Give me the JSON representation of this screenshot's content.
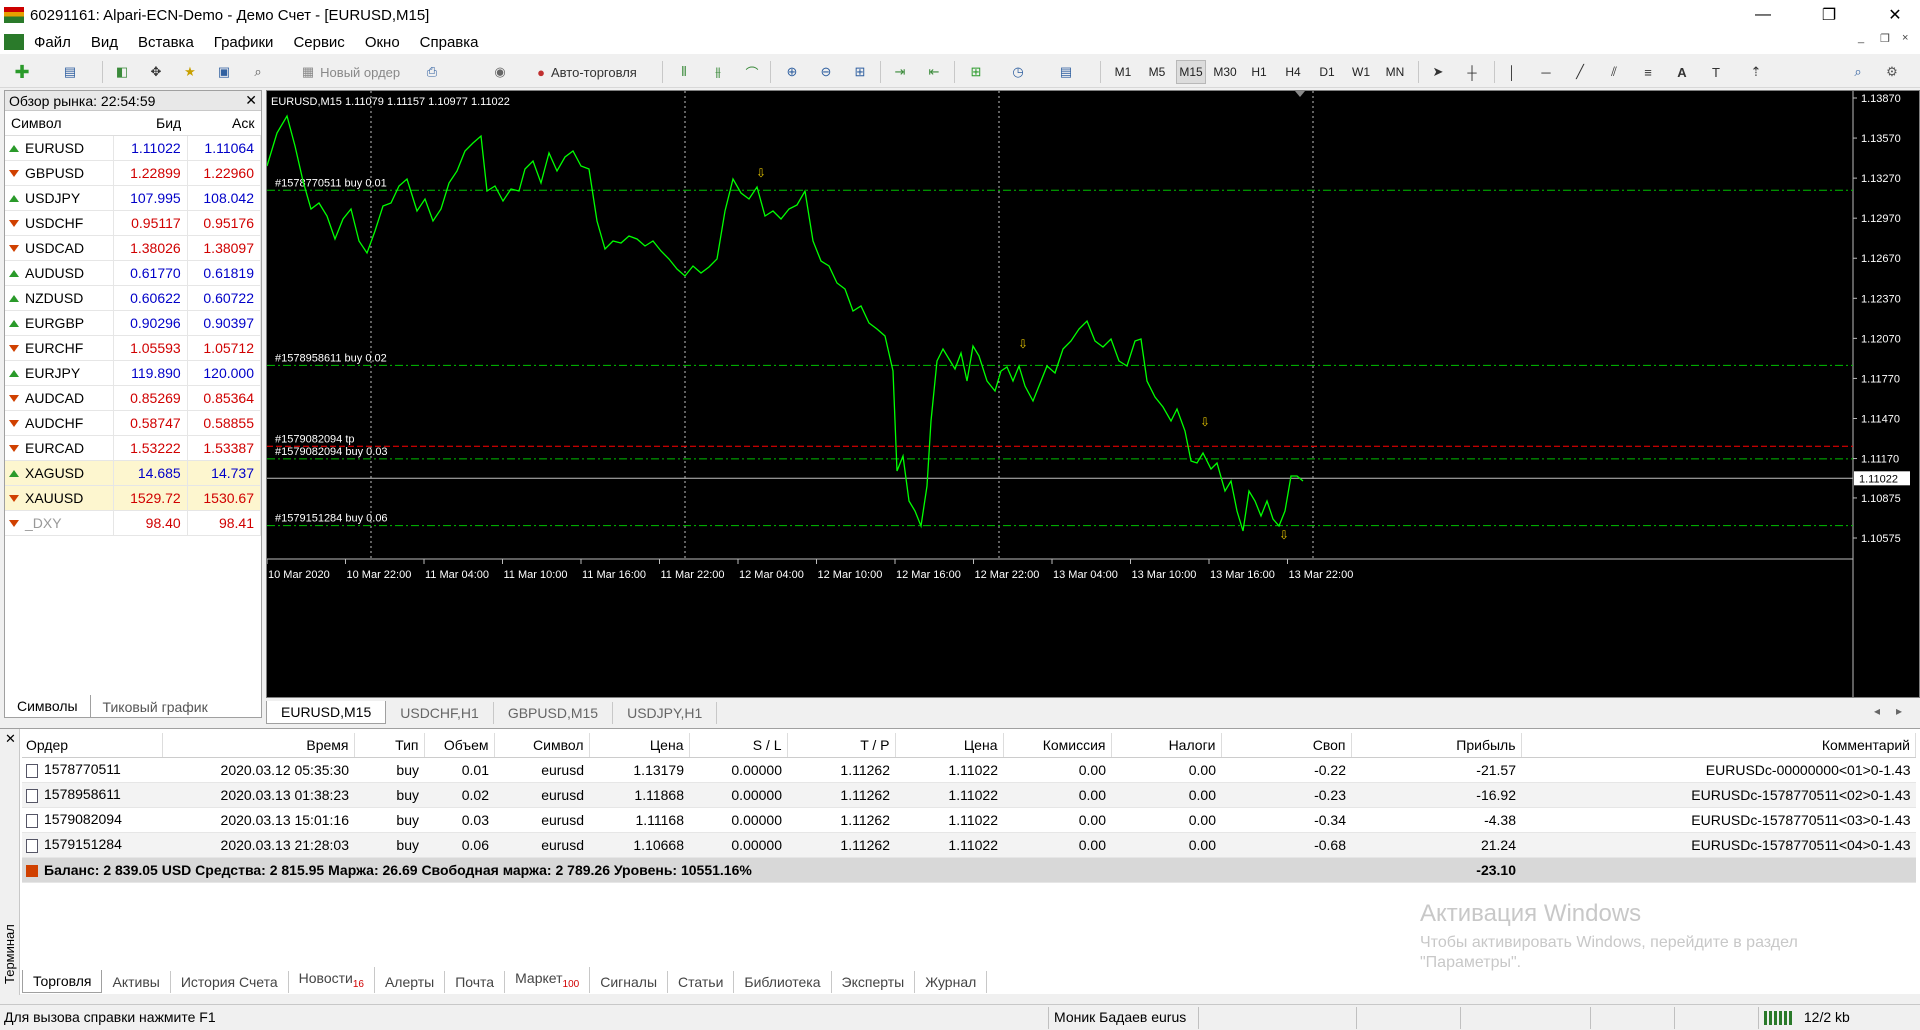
{
  "window": {
    "title": "60291161: Alpari-ECN-Demo - Демо Счет - [EURUSD,M15]",
    "minimize": "—",
    "maximize": "❐",
    "close": "✕"
  },
  "menu": {
    "items": [
      "Файл",
      "Вид",
      "Вставка",
      "Графики",
      "Сервис",
      "Окно",
      "Справка"
    ],
    "mdi_controls": [
      "_",
      "❐",
      "×"
    ]
  },
  "toolbar": {
    "new_order": "Новый ордер",
    "auto_trading": "Авто-торговля",
    "timeframes": [
      "M1",
      "M5",
      "M15",
      "M30",
      "H1",
      "H4",
      "D1",
      "W1",
      "MN"
    ],
    "active_timeframe": "M15"
  },
  "market_watch": {
    "header": "Обзор рынка: 22:54:59",
    "columns": [
      "Символ",
      "Бид",
      "Аск"
    ],
    "rows": [
      {
        "symbol": "EURUSD",
        "dir": "up",
        "bid": "1.11022",
        "ask": "1.11064",
        "color": "blue"
      },
      {
        "symbol": "GBPUSD",
        "dir": "down",
        "bid": "1.22899",
        "ask": "1.22960",
        "color": "red"
      },
      {
        "symbol": "USDJPY",
        "dir": "up",
        "bid": "107.995",
        "ask": "108.042",
        "color": "blue"
      },
      {
        "symbol": "USDCHF",
        "dir": "down",
        "bid": "0.95117",
        "ask": "0.95176",
        "color": "red"
      },
      {
        "symbol": "USDCAD",
        "dir": "down",
        "bid": "1.38026",
        "ask": "1.38097",
        "color": "red"
      },
      {
        "symbol": "AUDUSD",
        "dir": "up",
        "bid": "0.61770",
        "ask": "0.61819",
        "color": "blue"
      },
      {
        "symbol": "NZDUSD",
        "dir": "up",
        "bid": "0.60622",
        "ask": "0.60722",
        "color": "blue"
      },
      {
        "symbol": "EURGBP",
        "dir": "up",
        "bid": "0.90296",
        "ask": "0.90397",
        "color": "blue"
      },
      {
        "symbol": "EURCHF",
        "dir": "down",
        "bid": "1.05593",
        "ask": "1.05712",
        "color": "red"
      },
      {
        "symbol": "EURJPY",
        "dir": "up",
        "bid": "119.890",
        "ask": "120.000",
        "color": "blue"
      },
      {
        "symbol": "AUDCAD",
        "dir": "down",
        "bid": "0.85269",
        "ask": "0.85364",
        "color": "red"
      },
      {
        "symbol": "AUDCHF",
        "dir": "down",
        "bid": "0.58747",
        "ask": "0.58855",
        "color": "red"
      },
      {
        "symbol": "EURCAD",
        "dir": "down",
        "bid": "1.53222",
        "ask": "1.53387",
        "color": "red"
      },
      {
        "symbol": "XAGUSD",
        "dir": "up",
        "bid": "14.685",
        "ask": "14.737",
        "color": "blue",
        "highlight": true
      },
      {
        "symbol": "XAUUSD",
        "dir": "down",
        "bid": "1529.72",
        "ask": "1530.67",
        "color": "red",
        "highlight": true
      },
      {
        "symbol": "_DXY",
        "dir": "down",
        "bid": "98.40",
        "ask": "98.41",
        "color": "red",
        "muted": true
      }
    ],
    "tabs": [
      "Символы",
      "Тиковый график"
    ]
  },
  "chart": {
    "header": "EURUSD,M15  1.11079 1.11157 1.10977 1.11022",
    "price_ticks": [
      "1.13870",
      "1.13570",
      "1.13270",
      "1.12970",
      "1.12670",
      "1.12370",
      "1.12070",
      "1.11770",
      "1.11470",
      "1.11170",
      "1.10875",
      "1.10575"
    ],
    "current_price": "1.11022",
    "time_ticks": [
      "10 Mar 2020",
      "10 Mar 22:00",
      "11 Mar 04:00",
      "11 Mar 10:00",
      "11 Mar 16:00",
      "11 Mar 22:00",
      "12 Mar 04:00",
      "12 Mar 10:00",
      "12 Mar 16:00",
      "12 Mar 22:00",
      "13 Mar 04:00",
      "13 Mar 10:00",
      "13 Mar 16:00",
      "13 Mar 22:00"
    ],
    "order_labels": [
      {
        "text": "#1578770511 buy 0.01",
        "price": 1.13179
      },
      {
        "text": "#1578958611 buy 0.02",
        "price": 1.11868
      },
      {
        "text": "#1579082094 buy 0.03",
        "price": 1.11168
      },
      {
        "text": "#1579151284 buy 0.06",
        "price": 1.10668
      },
      {
        "text": "#1579082094 tp",
        "price": 1.11262
      }
    ],
    "tabs": [
      "EURUSD,M15",
      "USDCHF,H1",
      "GBPUSD,M15",
      "USDJPY,H1"
    ],
    "colors": {
      "line": "#00ff00",
      "grid": "#c0c0c0",
      "order": "#00c000",
      "tp": "#ff0000",
      "arrow": "#e0c000"
    }
  },
  "terminal": {
    "side_label": "Терминал",
    "columns": [
      "Ордер",
      "Время",
      "Тип",
      "Объем",
      "Символ",
      "Цена",
      "S / L",
      "T / P",
      "Цена",
      "Комиссия",
      "Налоги",
      "Своп",
      "Прибыль",
      "Комментарий"
    ],
    "rows": [
      [
        "1578770511",
        "2020.03.12 05:35:30",
        "buy",
        "0.01",
        "eurusd",
        "1.13179",
        "0.00000",
        "1.11262",
        "1.11022",
        "0.00",
        "0.00",
        "-0.22",
        "-21.57",
        "EURUSDc-00000000<01>0-1.43"
      ],
      [
        "1578958611",
        "2020.03.13 01:38:23",
        "buy",
        "0.02",
        "eurusd",
        "1.11868",
        "0.00000",
        "1.11262",
        "1.11022",
        "0.00",
        "0.00",
        "-0.23",
        "-16.92",
        "EURUSDc-1578770511<02>0-1.43"
      ],
      [
        "1579082094",
        "2020.03.13 15:01:16",
        "buy",
        "0.03",
        "eurusd",
        "1.11168",
        "0.00000",
        "1.11262",
        "1.11022",
        "0.00",
        "0.00",
        "-0.34",
        "-4.38",
        "EURUSDc-1578770511<03>0-1.43"
      ],
      [
        "1579151284",
        "2020.03.13 21:28:03",
        "buy",
        "0.06",
        "eurusd",
        "1.10668",
        "0.00000",
        "1.11262",
        "1.11022",
        "0.00",
        "0.00",
        "-0.68",
        "21.24",
        "EURUSDc-1578770511<04>0-1.43"
      ]
    ],
    "summary": "Баланс: 2 839.05 USD  Средства: 2 815.95  Маржа: 26.69  Свободная маржа: 2 789.26  Уровень: 10551.16%",
    "summary_profit": "-23.10",
    "tabs": [
      {
        "label": "Торговля"
      },
      {
        "label": "Активы"
      },
      {
        "label": "История Счета"
      },
      {
        "label": "Новости",
        "badge": "16"
      },
      {
        "label": "Алерты"
      },
      {
        "label": "Почта"
      },
      {
        "label": "Маркет",
        "badge": "100"
      },
      {
        "label": "Сигналы"
      },
      {
        "label": "Статьи"
      },
      {
        "label": "Библиотека"
      },
      {
        "label": "Эксперты"
      },
      {
        "label": "Журнал"
      }
    ]
  },
  "watermark": {
    "line1": "Активация Windows",
    "line2": "Чтобы активировать Windows, перейдите в раздел",
    "line3": "\"Параметры\"."
  },
  "statusbar": {
    "help": "Для вызова справки нажмите F1",
    "profile": "Моник Бадаев eurus",
    "traffic": "12/2 kb"
  }
}
